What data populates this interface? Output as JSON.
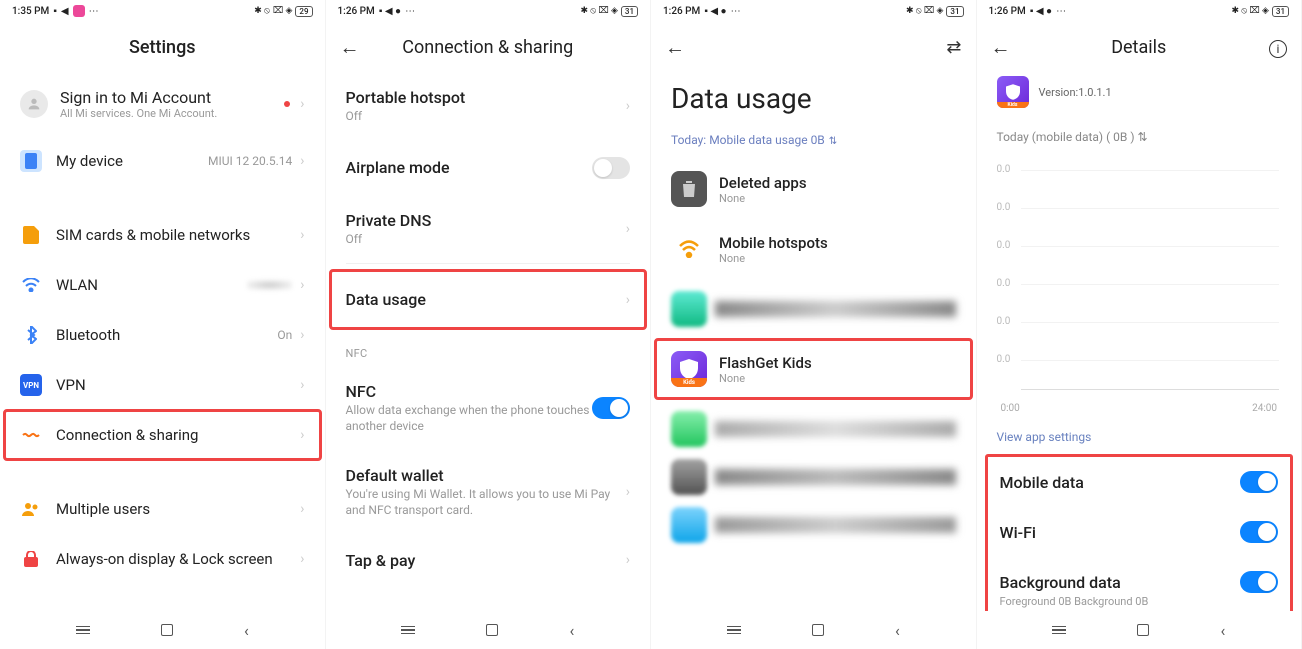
{
  "phones": {
    "p1": {
      "status_time": "1:35 PM",
      "battery": "29",
      "header": "Settings",
      "account_title": "Sign in to Mi Account",
      "account_sub": "All Mi services. One Mi Account.",
      "items": {
        "mydevice": {
          "title": "My device",
          "value": "MIUI 12 20.5.14"
        },
        "sim": {
          "title": "SIM cards & mobile networks"
        },
        "wlan": {
          "title": "WLAN"
        },
        "bt": {
          "title": "Bluetooth",
          "value": "On"
        },
        "vpn": {
          "title": "VPN"
        },
        "conn": {
          "title": "Connection & sharing"
        },
        "multi": {
          "title": "Multiple users"
        },
        "aod": {
          "title": "Always-on display & Lock screen"
        }
      }
    },
    "p2": {
      "status_time": "1:26 PM",
      "battery": "31",
      "header": "Connection & sharing",
      "items": {
        "hotspot": {
          "title": "Portable hotspot",
          "sub": "Off"
        },
        "airplane": {
          "title": "Airplane mode"
        },
        "dns": {
          "title": "Private DNS",
          "sub": "Off"
        },
        "data": {
          "title": "Data usage"
        },
        "nfc_section": "NFC",
        "nfc": {
          "title": "NFC",
          "sub": "Allow data exchange when the phone touches another device"
        },
        "wallet": {
          "title": "Default wallet",
          "sub": "You're using Mi Wallet. It allows you to use Mi Pay and NFC transport card."
        },
        "tap": {
          "title": "Tap & pay"
        }
      }
    },
    "p3": {
      "status_time": "1:26 PM",
      "battery": "31",
      "header": "Data usage",
      "filter": "Today: Mobile data usage 0B",
      "apps": {
        "deleted": {
          "title": "Deleted apps",
          "sub": "None"
        },
        "hotspots": {
          "title": "Mobile hotspots",
          "sub": "None"
        },
        "flashget": {
          "title": "FlashGet Kids",
          "sub": "None"
        }
      }
    },
    "p4": {
      "status_time": "1:26 PM",
      "battery": "31",
      "header": "Details",
      "version": "Version:1.0.1.1",
      "dropdown": "Today (mobile data) ( 0B )",
      "chart": {
        "y_vals": [
          "0.0",
          "0.0",
          "0.0",
          "0.0",
          "0.0",
          "0.0"
        ],
        "x_left": "0:00",
        "x_right": "24:00"
      },
      "view_link": "View app settings",
      "rows": {
        "mobile": {
          "title": "Mobile data"
        },
        "wifi": {
          "title": "Wi-Fi"
        },
        "bg": {
          "title": "Background data",
          "sub": "Foreground 0B  Background 0B"
        }
      }
    }
  },
  "chart_data": {
    "type": "bar",
    "title": "Today (mobile data) ( 0B )",
    "x": [
      "0:00",
      "24:00"
    ],
    "values": [
      0,
      0,
      0,
      0,
      0,
      0,
      0,
      0,
      0,
      0,
      0,
      0,
      0,
      0,
      0,
      0,
      0,
      0,
      0,
      0,
      0,
      0,
      0,
      0
    ],
    "ylim": [
      0,
      0
    ]
  }
}
